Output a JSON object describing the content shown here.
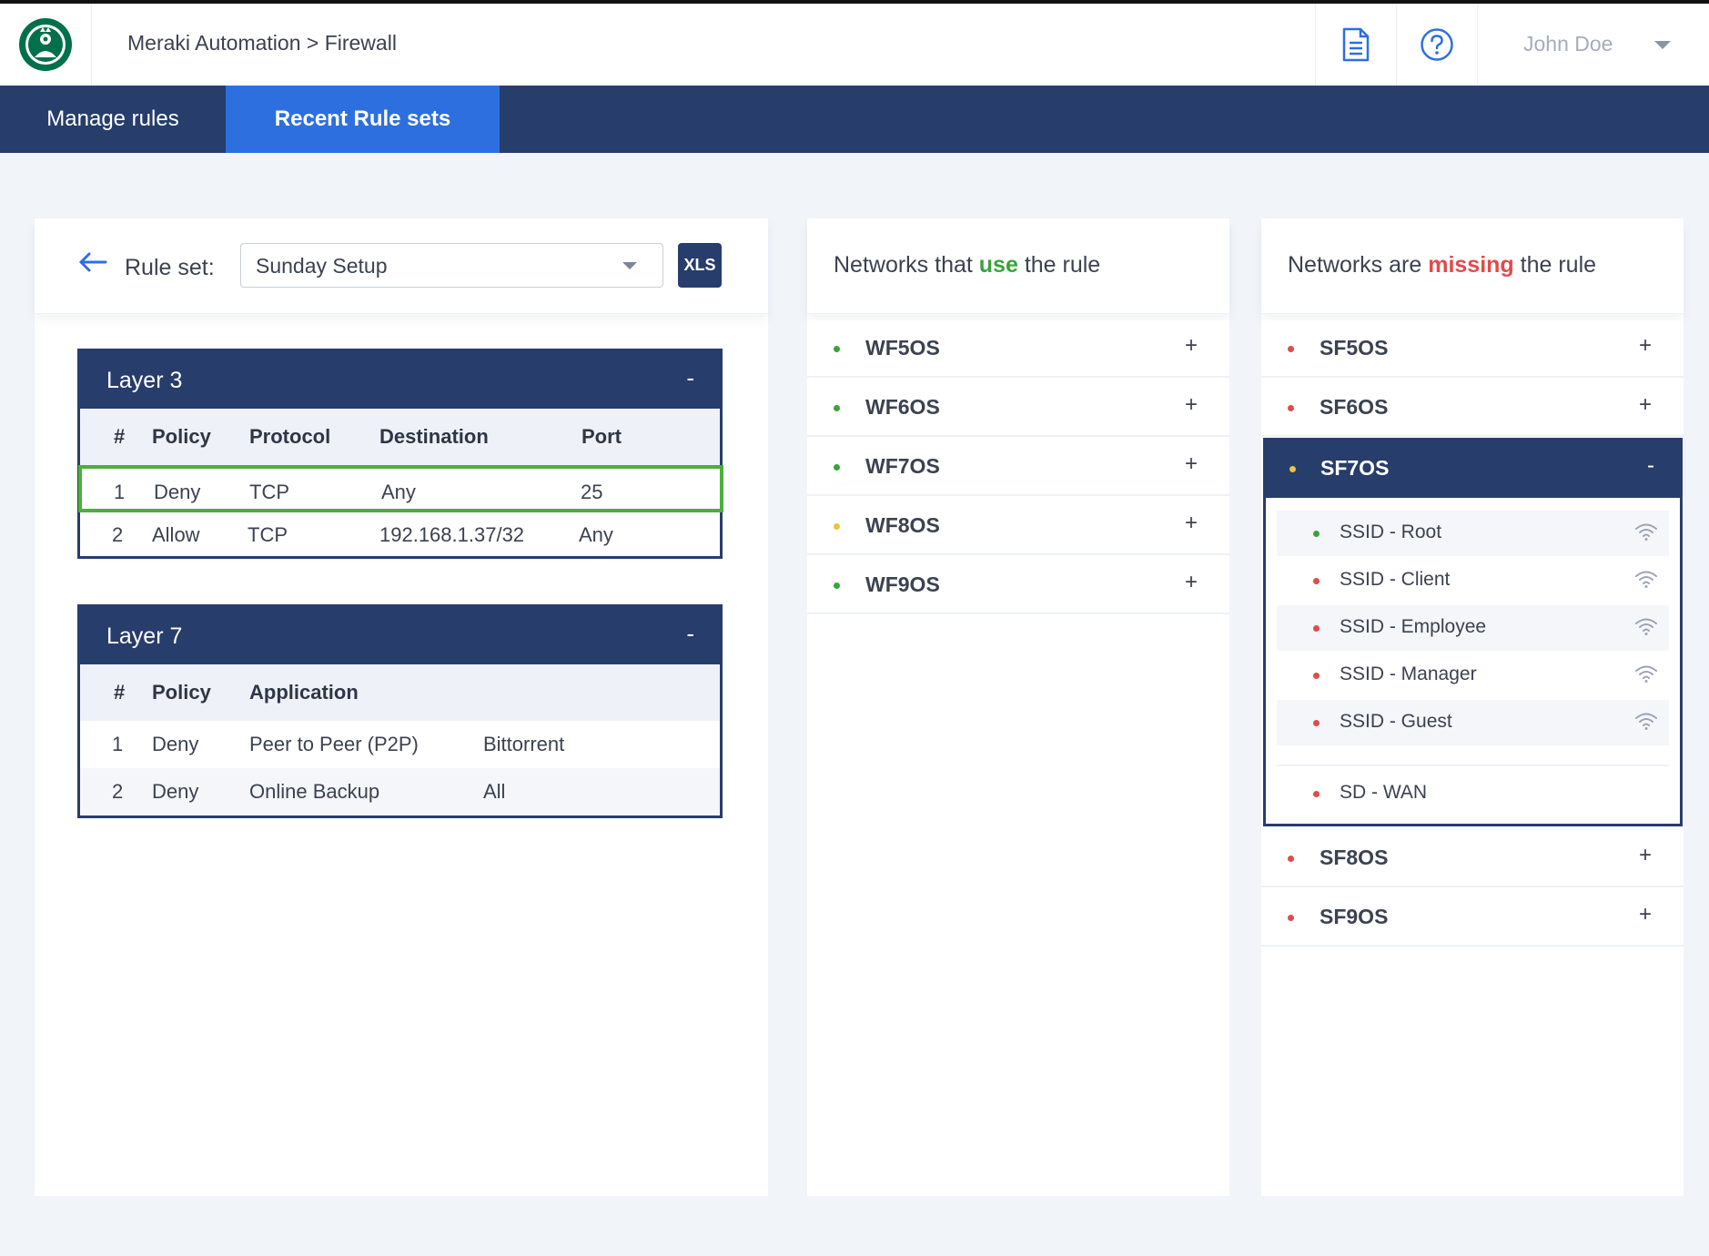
{
  "header": {
    "breadcrumb": "Meraki Automation > Firewall",
    "user_name": "John Doe"
  },
  "nav": {
    "tabs": [
      {
        "label": "Manage rules",
        "active": false
      },
      {
        "label": "Recent Rule sets",
        "active": true
      }
    ]
  },
  "ruleset": {
    "label": "Rule set:",
    "selected": "Sunday Setup",
    "export_label": "XLS"
  },
  "layer3": {
    "title": "Layer 3",
    "collapse": "-",
    "columns": [
      "#",
      "Policy",
      "Protocol",
      "Destination",
      "Port"
    ],
    "rows": [
      {
        "num": "1",
        "policy": "Deny",
        "protocol": "TCP",
        "destination": "Any",
        "port": "25",
        "selected": true
      },
      {
        "num": "2",
        "policy": "Allow",
        "protocol": "TCP",
        "destination": "192.168.1.37/32",
        "port": "Any",
        "selected": false
      }
    ]
  },
  "layer7": {
    "title": "Layer 7",
    "collapse": "-",
    "columns": [
      "#",
      "Policy",
      "Application"
    ],
    "rows": [
      {
        "num": "1",
        "policy": "Deny",
        "application": "Peer to Peer (P2P)",
        "detail": "Bittorrent"
      },
      {
        "num": "2",
        "policy": "Deny",
        "application": "Online Backup",
        "detail": "All"
      }
    ]
  },
  "using": {
    "title_pre": "Networks that ",
    "title_highlight": "use",
    "title_post": " the rule",
    "networks": [
      {
        "name": "WF5OS",
        "status": "green",
        "action": "+"
      },
      {
        "name": "WF6OS",
        "status": "green",
        "action": "+"
      },
      {
        "name": "WF7OS",
        "status": "green",
        "action": "+"
      },
      {
        "name": "WF8OS",
        "status": "yellow",
        "action": "+"
      },
      {
        "name": "WF9OS",
        "status": "green",
        "action": "+"
      }
    ]
  },
  "missing": {
    "title_pre": "Networks are ",
    "title_highlight": "missing",
    "title_post": " the rule",
    "networks": [
      {
        "name": "SF5OS",
        "status": "red",
        "action": "+"
      },
      {
        "name": "SF6OS",
        "status": "red",
        "action": "+"
      },
      {
        "name": "SF8OS",
        "status": "red",
        "action": "+"
      },
      {
        "name": "SF9OS",
        "status": "red",
        "action": "+"
      }
    ],
    "expanded": {
      "name": "SF7OS",
      "status": "yellow",
      "action": "-",
      "ssids": [
        {
          "name": "SSID - Root",
          "status": "green"
        },
        {
          "name": "SSID - Client",
          "status": "red"
        },
        {
          "name": "SSID - Employee",
          "status": "red"
        },
        {
          "name": "SSID - Manager",
          "status": "red"
        },
        {
          "name": "SSID - Guest",
          "status": "red"
        }
      ],
      "wan": {
        "name": "SD - WAN",
        "status": "red"
      }
    }
  },
  "colors": {
    "navy": "#273d6b",
    "active_tab": "#2e6fe0",
    "green": "#3aa33a",
    "yellow": "#f0c23a",
    "red": "#e04b4b",
    "selected_row_border": "#4caf3d"
  },
  "icons": [
    "starbucks-logo",
    "document-icon",
    "help-icon",
    "chevron-down-icon",
    "back-arrow-icon",
    "wifi-icon"
  ]
}
